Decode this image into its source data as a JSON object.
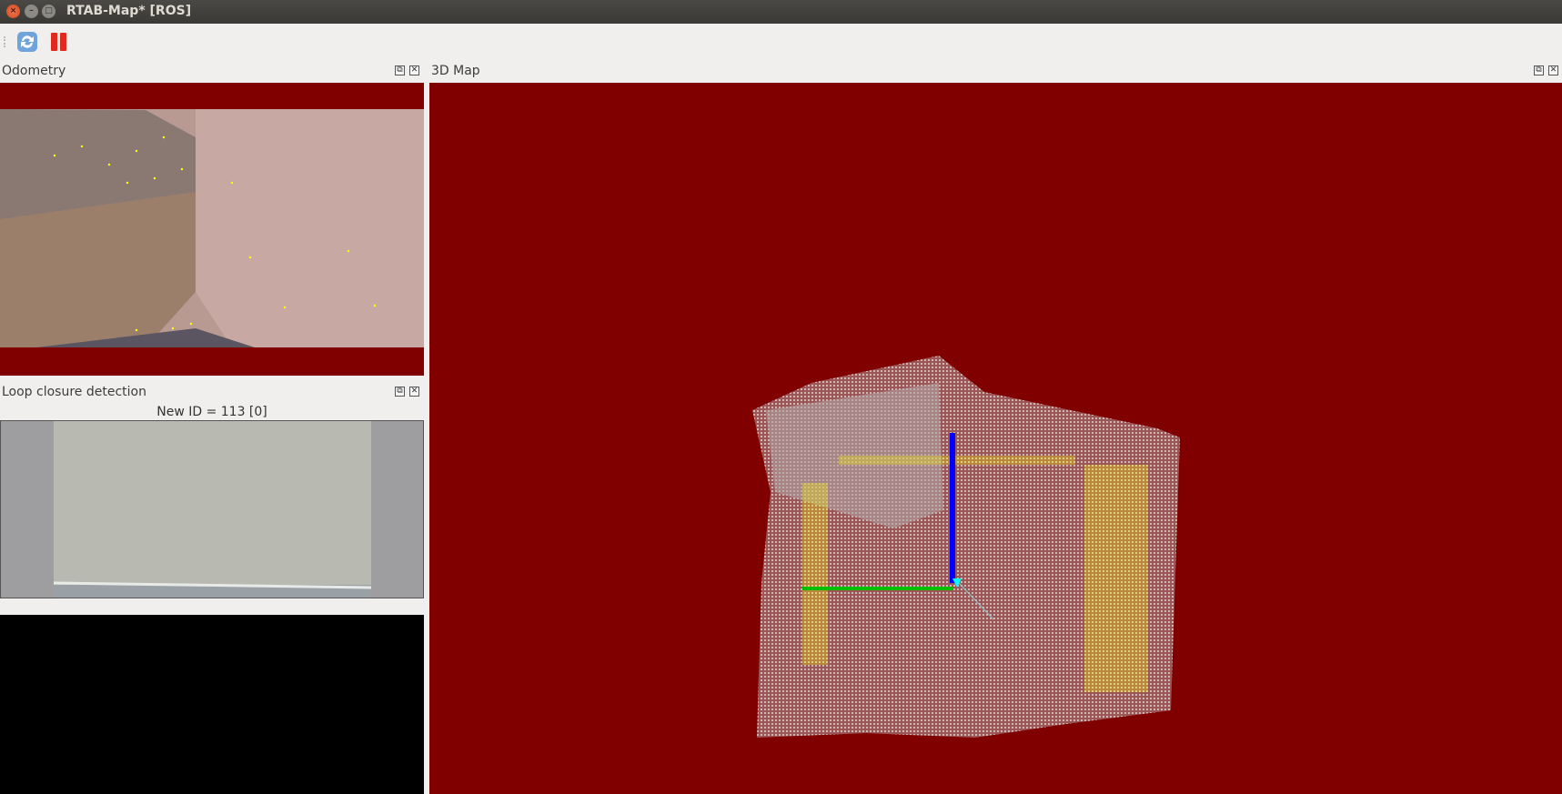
{
  "window": {
    "title": "RTAB-Map* [ROS]",
    "close": "×",
    "minimize": "–",
    "maximize": "□"
  },
  "toolbar": {
    "buttons": [
      {
        "name": "refresh-icon"
      },
      {
        "name": "pause-icon"
      }
    ]
  },
  "docks": {
    "odometry": {
      "title": "Odometry"
    },
    "map3d": {
      "title": "3D Map"
    },
    "loop": {
      "title": "Loop closure detection",
      "status": "New ID = 113 [0]"
    }
  },
  "dock_icons": {
    "float": "⧉",
    "close": "✕"
  },
  "colors": {
    "background": "#800000",
    "feature": "#ffff00",
    "axis_x": "#00c000",
    "axis_z": "#0000ff"
  }
}
